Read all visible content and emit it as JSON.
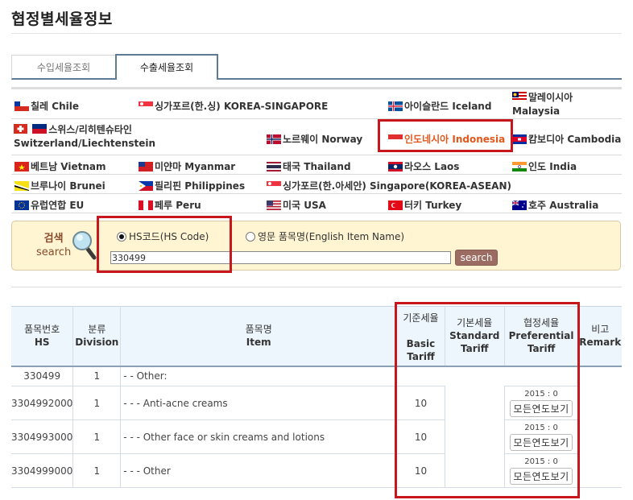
{
  "page": {
    "title": "협정별세율정보"
  },
  "tabs": [
    {
      "label": "수입세율조회",
      "active": false
    },
    {
      "label": "수출세율조회",
      "active": true
    }
  ],
  "countries": [
    {
      "flag": "chile",
      "label": "칠레 Chile"
    },
    {
      "flag": "singapore",
      "label": "싱가포르(한.싱) KOREA-SINGAPORE"
    },
    {
      "flag": "iceland",
      "label": "아이슬란드 Iceland"
    },
    {
      "flag": "malaysia",
      "label_ko": "말레이시아",
      "label_en": "Malaysia"
    },
    {
      "flag": "switzerland-liechtenstein",
      "label_ko": "스위스/리히텐슈타인",
      "label_en": "Switzerland/Liechtenstein"
    },
    {
      "flag": "norway",
      "label": "노르웨이 Norway"
    },
    {
      "flag": "indonesia",
      "label": "인도네시아 Indonesia",
      "selected": true
    },
    {
      "flag": "cambodia",
      "label": "캄보디아 Cambodia"
    },
    {
      "flag": "vietnam",
      "label": "베트남 Vietnam"
    },
    {
      "flag": "myanmar",
      "label": "미얀마 Myanmar"
    },
    {
      "flag": "thailand",
      "label": "태국 Thailand"
    },
    {
      "flag": "laos",
      "label": "라오스 Laos"
    },
    {
      "flag": "india",
      "label": "인도 India"
    },
    {
      "flag": "brunei",
      "label": "브루나이 Brunei"
    },
    {
      "flag": "philippines",
      "label": "필리핀 Philippines"
    },
    {
      "flag": "singapore",
      "label": "싱가포르(한.아세안) Singapore(KOREA-ASEAN)"
    },
    {
      "flag": "eu",
      "label": "유럽연합 EU"
    },
    {
      "flag": "peru",
      "label": "페루 Peru"
    },
    {
      "flag": "usa",
      "label": "미국 USA"
    },
    {
      "flag": "turkey",
      "label": "터키 Turkey"
    },
    {
      "flag": "australia",
      "label": "호주 Australia"
    }
  ],
  "search": {
    "label_ko": "검색",
    "label_en": "search",
    "radio_hs": "HS코드(HS Code)",
    "radio_hs_checked": true,
    "radio_name": "영문 품목명(English Item Name)",
    "radio_name_checked": false,
    "input_value": "330499",
    "button_label": "search"
  },
  "table": {
    "headers": [
      {
        "ko": "품목번호",
        "en": "HS"
      },
      {
        "ko": "분류",
        "en": "Division"
      },
      {
        "ko": "품목명",
        "en": "Item"
      },
      {
        "ko": "기준세율",
        "en": "Basic Tariff"
      },
      {
        "ko": "기본세율",
        "en": "Standard Tariff"
      },
      {
        "ko": "협정세율",
        "en": "Preferential Tariff"
      },
      {
        "ko": "비고",
        "en": "Remark"
      }
    ],
    "rows": [
      {
        "hs": "330499",
        "division": "1",
        "item": "- - Other:",
        "basic": "",
        "standard": "",
        "preferential_year": "",
        "button": "",
        "remark": ""
      },
      {
        "hs": "3304992000",
        "division": "1",
        "item": "- - - Anti-acne creams",
        "basic": "10",
        "standard": "",
        "preferential_year": "2015 : 0",
        "button": "모든연도보기",
        "remark": ""
      },
      {
        "hs": "3304993000",
        "division": "1",
        "item": "- - - Other face or skin creams and lotions",
        "basic": "10",
        "standard": "",
        "preferential_year": "2015 : 0",
        "button": "모든연도보기",
        "remark": ""
      },
      {
        "hs": "3304999000",
        "division": "1",
        "item": "- - - Other",
        "basic": "10",
        "standard": "",
        "preferential_year": "2015 : 0",
        "button": "모든연도보기",
        "remark": ""
      }
    ]
  },
  "colors": {
    "highlight_red": "#c8161d",
    "selected_country": "#e2571b",
    "tab_border": "#5f7a94",
    "search_bg": "#fff5d2",
    "search_button": "#9c6c62",
    "header_bg": "#eef6fd"
  }
}
